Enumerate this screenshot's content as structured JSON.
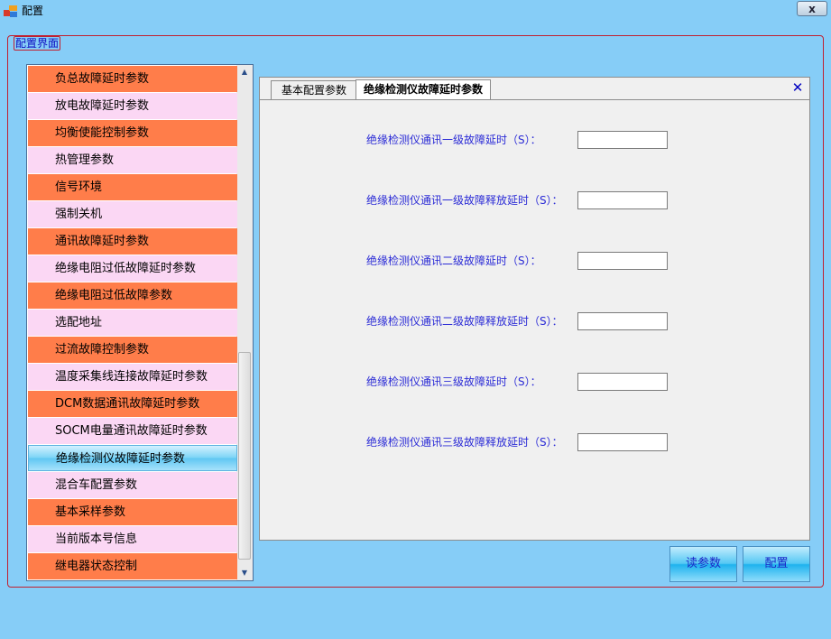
{
  "window": {
    "title": "配置",
    "close_symbol": "x",
    "icon": "app-window-icon"
  },
  "group": {
    "title": "配置界面"
  },
  "sidebar": {
    "items": [
      {
        "label": "负总故障延时参数",
        "style": "dark"
      },
      {
        "label": "放电故障延时参数",
        "style": "light"
      },
      {
        "label": "均衡使能控制参数",
        "style": "dark"
      },
      {
        "label": "热管理参数",
        "style": "light"
      },
      {
        "label": "信号环境",
        "style": "dark"
      },
      {
        "label": "强制关机",
        "style": "light"
      },
      {
        "label": "通讯故障延时参数",
        "style": "dark"
      },
      {
        "label": "绝缘电阻过低故障延时参数",
        "style": "light"
      },
      {
        "label": "绝缘电阻过低故障参数",
        "style": "dark"
      },
      {
        "label": "选配地址",
        "style": "light"
      },
      {
        "label": "过流故障控制参数",
        "style": "dark"
      },
      {
        "label": "温度采集线连接故障延时参数",
        "style": "light"
      },
      {
        "label": "DCM数据通讯故障延时参数",
        "style": "dark"
      },
      {
        "label": "SOCM电量通讯故障延时参数",
        "style": "light"
      },
      {
        "label": "绝缘检测仪故障延时参数",
        "style": "selected"
      },
      {
        "label": "混合车配置参数",
        "style": "light"
      },
      {
        "label": "基本采样参数",
        "style": "dark"
      },
      {
        "label": "当前版本号信息",
        "style": "light"
      },
      {
        "label": "继电器状态控制",
        "style": "dark"
      }
    ],
    "selected_index": 14
  },
  "tabs": [
    {
      "label": "基本配置参数",
      "active": false
    },
    {
      "label": "绝缘检测仪故障延时参数",
      "active": true
    }
  ],
  "tab_close_symbol": "✕",
  "form": {
    "fields": [
      {
        "label": "绝缘检测仪通讯一级故障延时（S）：",
        "value": ""
      },
      {
        "label": "绝缘检测仪通讯一级故障释放延时（S）：",
        "value": ""
      },
      {
        "label": "绝缘检测仪通讯二级故障延时（S）：",
        "value": ""
      },
      {
        "label": "绝缘检测仪通讯二级故障释放延时（S）：",
        "value": ""
      },
      {
        "label": "绝缘检测仪通讯三级故障延时（S）：",
        "value": ""
      },
      {
        "label": "绝缘检测仪通讯三级故障释放延时（S）：",
        "value": ""
      }
    ]
  },
  "buttons": {
    "read_label": "读参数",
    "config_label": "配置"
  },
  "colors": {
    "window_bg": "#86cdf7",
    "item_dark": "#ff7d4a",
    "item_light": "#fbd7f4",
    "label_blue": "#2b2bd6",
    "group_border": "#c02030"
  }
}
